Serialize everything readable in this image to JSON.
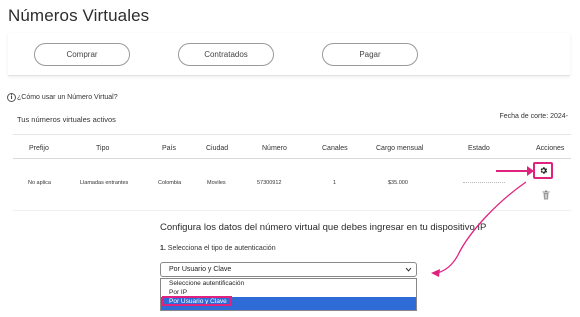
{
  "page": {
    "title": "Números Virtuales"
  },
  "actions": {
    "buttons": [
      "Comprar",
      "Contratados",
      "Pagar"
    ]
  },
  "help": {
    "icon": "info-icon",
    "text": "¿Cómo usar un Número Virtual?"
  },
  "section": {
    "title": "Tus números virtuales activos",
    "cutoff": "Fecha de corte: 2024-"
  },
  "table": {
    "headers": [
      "Prefijo",
      "Tipo",
      "País",
      "Ciudad",
      "Número",
      "Canales",
      "Cargo mensual",
      "Estado",
      "Acciones"
    ],
    "rows": [
      [
        "No aplica",
        "Llamadas entrantes",
        "Colombia",
        "Moviles",
        "57300912",
        "1",
        "$35.000",
        "",
        ""
      ]
    ]
  },
  "config": {
    "title": "Configura los datos del número virtual que debes ingresar en tu dispositivo IP",
    "step_number": "1.",
    "step_text": "Selecciona el tipo de autenticación",
    "selected": "Por Usuario y Clave",
    "options": [
      "Seleccione autentificación",
      "Por IP",
      "Por Usuario y Clave"
    ]
  },
  "colors": {
    "accent": "#e0227f",
    "selection": "#2f6bd6"
  }
}
